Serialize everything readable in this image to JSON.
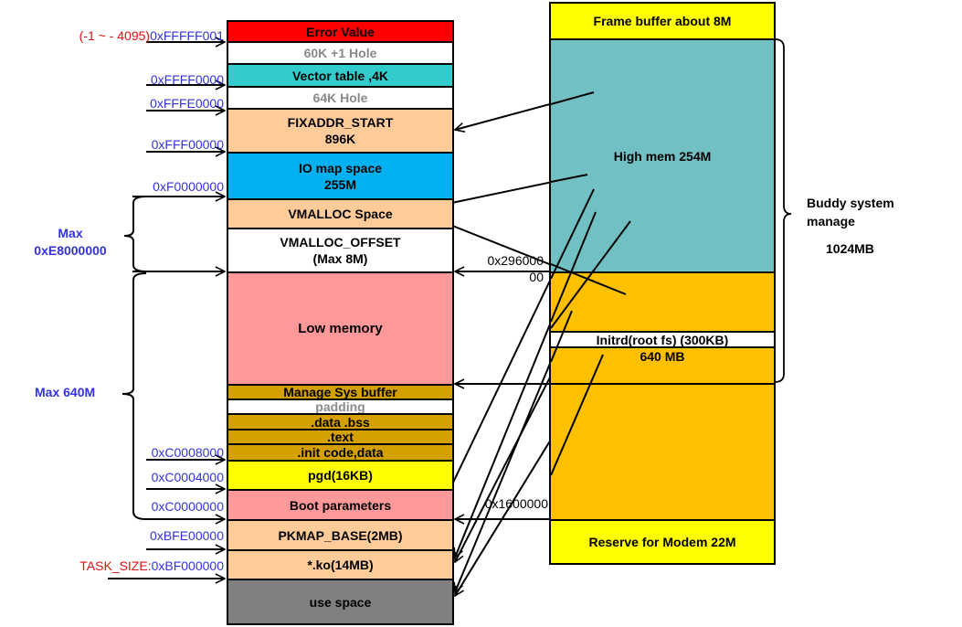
{
  "left_column": {
    "blocks": [
      {
        "id": "error-value",
        "lines": [
          "Error Value"
        ],
        "color": "#ff0000"
      },
      {
        "id": "hole-60k",
        "lines": [
          "60K +1 Hole"
        ],
        "color": "#ffffff",
        "muted": true
      },
      {
        "id": "vector-table",
        "lines": [
          "Vector table ,4K"
        ],
        "color": "#33cccc"
      },
      {
        "id": "hole-64k",
        "lines": [
          "64K Hole"
        ],
        "color": "#ffffff",
        "muted": true
      },
      {
        "id": "fixaddr",
        "lines": [
          "FIXADDR_START",
          "896K"
        ],
        "color": "#ffcc99"
      },
      {
        "id": "io-map",
        "lines": [
          "IO map space",
          "255M"
        ],
        "color": "#00b0f0"
      },
      {
        "id": "vmalloc-space",
        "lines": [
          "VMALLOC Space"
        ],
        "color": "#ffcc99"
      },
      {
        "id": "vmalloc-offset",
        "lines": [
          "VMALLOC_OFFSET",
          "(Max 8M)"
        ],
        "color": "#ffffff"
      },
      {
        "id": "low-memory",
        "lines": [
          "Low memory"
        ],
        "color": "#ff9999"
      },
      {
        "id": "manage-sys-buffer",
        "lines": [
          "Manage Sys buffer"
        ],
        "color": "#d4a000"
      },
      {
        "id": "padding",
        "lines": [
          "padding"
        ],
        "color": "#ffffff",
        "muted": true
      },
      {
        "id": "data-bss",
        "lines": [
          ".data  .bss"
        ],
        "color": "#d4a000"
      },
      {
        "id": "text",
        "lines": [
          ".text"
        ],
        "color": "#d4a000"
      },
      {
        "id": "init-code",
        "lines": [
          ".init code,data"
        ],
        "color": "#d4a000"
      },
      {
        "id": "pgd",
        "lines": [
          "pgd(16KB)"
        ],
        "color": "#ffff00"
      },
      {
        "id": "boot-parameters",
        "lines": [
          "Boot parameters"
        ],
        "color": "#ff9999"
      },
      {
        "id": "pkmap-base",
        "lines": [
          "PKMAP_BASE(2MB)"
        ],
        "color": "#ffcc99"
      },
      {
        "id": "ko-modules",
        "lines": [
          "*.ko(14MB)"
        ],
        "color": "#ffcc99"
      },
      {
        "id": "user-space",
        "lines": [
          "use space"
        ],
        "color": "#808080"
      }
    ]
  },
  "addresses": [
    {
      "id": "error",
      "prefix": "(-1 ~ - 4095)",
      "value": "0xFFFFF001"
    },
    {
      "id": "vector",
      "prefix": "",
      "value": "0xFFFF0000"
    },
    {
      "id": "fixaddr-top",
      "prefix": "",
      "value": "0xFFFE0000"
    },
    {
      "id": "io-top",
      "prefix": "",
      "value": "0xFFF00000"
    },
    {
      "id": "vmalloc-top",
      "prefix": "",
      "value": "0xF0000000"
    },
    {
      "id": "init",
      "prefix": "",
      "value": "0xC0008000"
    },
    {
      "id": "pgd",
      "prefix": "",
      "value": "0xC0004000"
    },
    {
      "id": "page-offset",
      "prefix": "",
      "value": "0xC0000000"
    },
    {
      "id": "pkmap",
      "prefix": "",
      "value": "0xBFE00000"
    },
    {
      "id": "task-size",
      "prefix": "TASK_SIZE:",
      "value": "0xBF000000"
    }
  ],
  "brace_labels": {
    "max_e8": [
      "Max",
      "0xE8000000"
    ],
    "max_640": "Max 640M"
  },
  "right_column": {
    "frame_buffer": "Frame buffer about 8M",
    "high_mem": "High mem 254M",
    "initrd": "Initrd(root fs) (300KB)",
    "low_640": "640 MB",
    "modem": "Reserve for Modem 22M",
    "colors": {
      "frame_buffer": "#ffff00",
      "high_mem": "#70c0c4",
      "low_640": "#ffc000",
      "initrd": "#ffffff",
      "modem": "#ffff00"
    }
  },
  "boundaries": {
    "phys_296": [
      "0x296000",
      "00"
    ],
    "phys_16": "0x1600000"
  },
  "buddy": {
    "lines": [
      "Buddy system",
      "manage"
    ],
    "size": "1024MB"
  }
}
